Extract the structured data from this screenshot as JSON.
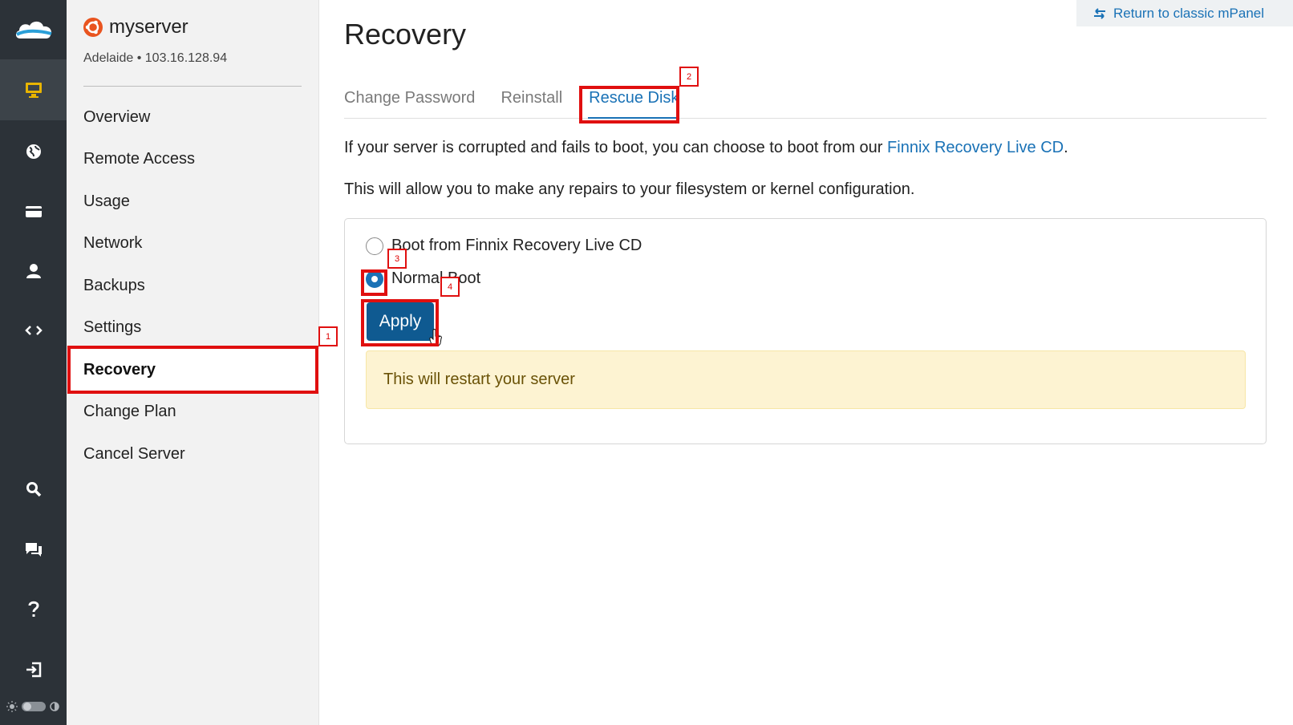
{
  "sidebar_rail": {
    "logo_icon": "cloud-logo-icon",
    "items": [
      {
        "name": "servers",
        "icon": "monitor-icon",
        "active": true
      },
      {
        "name": "domains",
        "icon": "globe-icon",
        "active": false
      },
      {
        "name": "billing",
        "icon": "credit-card-icon",
        "active": false
      },
      {
        "name": "account",
        "icon": "user-icon",
        "active": false
      },
      {
        "name": "api",
        "icon": "code-icon",
        "active": false
      },
      {
        "name": "search",
        "icon": "search-icon",
        "active": false
      },
      {
        "name": "chat",
        "icon": "chat-icon",
        "active": false
      },
      {
        "name": "help",
        "icon": "question-icon",
        "active": false
      },
      {
        "name": "logout",
        "icon": "logout-icon",
        "active": false
      }
    ]
  },
  "server": {
    "name": "myserver",
    "meta": "Adelaide • 103.16.128.94",
    "os_icon": "ubuntu-icon"
  },
  "nav": {
    "items": [
      {
        "label": "Overview"
      },
      {
        "label": "Remote Access"
      },
      {
        "label": "Usage"
      },
      {
        "label": "Network"
      },
      {
        "label": "Backups"
      },
      {
        "label": "Settings"
      },
      {
        "label": "Recovery",
        "active": true
      },
      {
        "label": "Change Plan"
      },
      {
        "label": "Cancel Server"
      }
    ]
  },
  "top_link": {
    "label": "Return to classic mPanel",
    "icon": "swap-arrows-icon"
  },
  "page": {
    "title": "Recovery",
    "tabs": [
      {
        "label": "Change Password"
      },
      {
        "label": "Reinstall"
      },
      {
        "label": "Rescue Disk",
        "active": true
      }
    ],
    "intro_prefix": "If your server is corrupted and fails to boot, you can choose to boot from our ",
    "intro_link": "Finnix Recovery Live CD",
    "intro_suffix": ".",
    "description": "This will allow you to make any repairs to your filesystem or kernel configuration."
  },
  "form": {
    "options": [
      {
        "label": "Boot from Finnix Recovery Live CD",
        "selected": false
      },
      {
        "label": "Normal Boot",
        "selected": true
      }
    ],
    "apply_label": "Apply",
    "warning": "This will restart your server"
  },
  "annotations": {
    "labels": [
      "1",
      "2",
      "3",
      "4"
    ],
    "color": "#e00f0f"
  },
  "colors": {
    "rail_bg": "#2c3238",
    "accent": "#1a72b6",
    "button": "#0f5a91",
    "warning_bg": "#fdf3d2"
  }
}
